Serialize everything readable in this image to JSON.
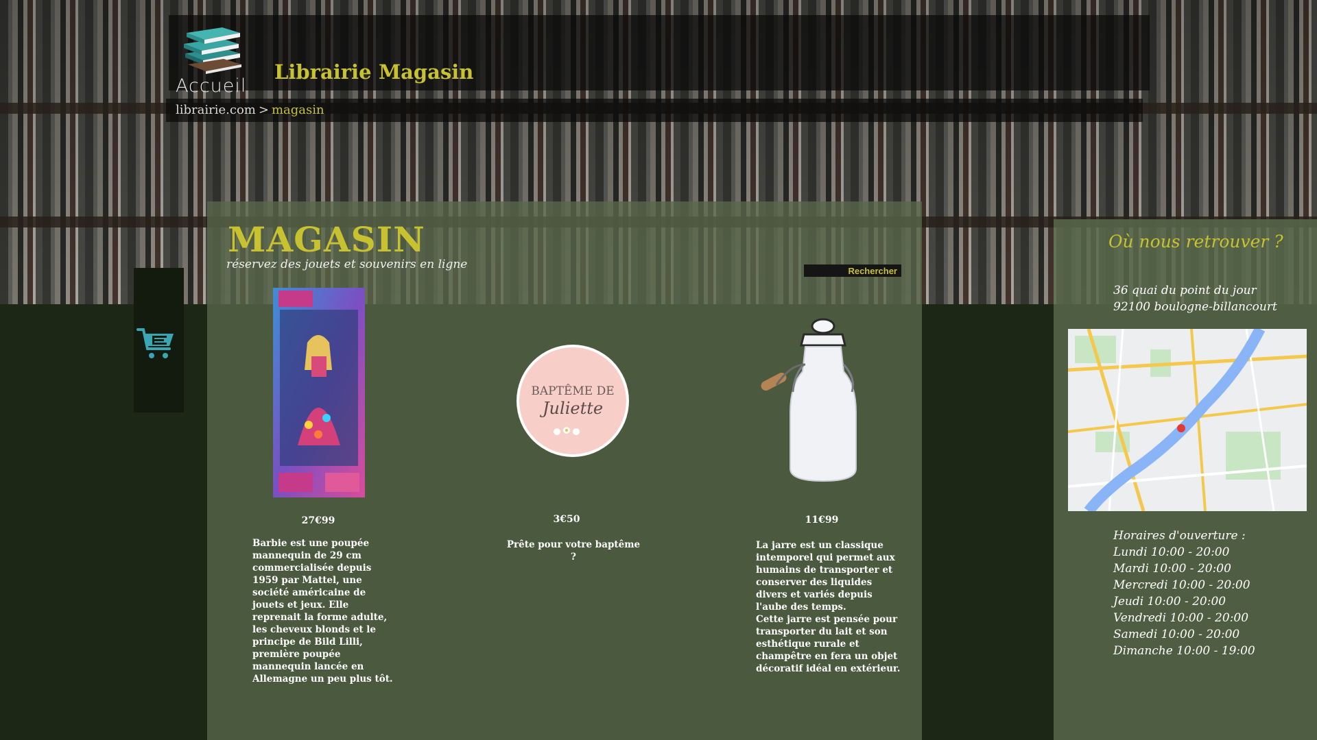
{
  "nav": {
    "home_label": "Accueil",
    "links": [
      "Librairie",
      "Magasin"
    ]
  },
  "breadcrumb": {
    "home": "librairie.com",
    "separator": ">",
    "current": "magasin"
  },
  "main": {
    "title": "MAGASIN",
    "subtitle": "réservez des jouets et souvenirs en ligne",
    "search_label": "Rechercher"
  },
  "products": [
    {
      "price": "27€99",
      "description": "Barbie est une poupée\nmannequin de 29 cm\ncommercialisée depuis\n1959 par Mattel, une\nsociété américaine de\njouets et jeux. Elle\nreprenait la forme adulte,\nles cheveux blonds et le\nprincipe de Bild Lilli,\npremière poupée\nmannequin lancée en\nAllemagne un peu plus tôt."
    },
    {
      "price": "3€50",
      "description": "Prête pour votre baptême ?",
      "badge_line1": "BAPTÊME DE",
      "badge_line2": "Juliette"
    },
    {
      "price": "11€99",
      "description": "La jarre est un classique\nintemporel qui permet aux\nhumains de transporter et\nconserver des liquides\ndivers et variés depuis\nl'aube des temps.\nCette jarre est pensée pour\ntransporter du lait et son\nesthétique rurale et\nchampêtre en fera un objet\ndécoratif idéal en extérieur."
    }
  ],
  "sidebar": {
    "title": "Où nous retrouver ?",
    "address": [
      "36 quai du point du jour",
      "92100 boulogne-billancourt"
    ],
    "hours_title": "Horaires d'ouverture :",
    "hours": [
      "Lundi 10:00 - 20:00",
      "Mardi 10:00 - 20:00",
      "Mercredi 10:00 - 20:00",
      "Jeudi 10:00 - 20:00",
      "Vendredi 10:00 - 20:00",
      "Samedi 10:00 - 20:00",
      "Dimanche 10:00 - 19:00"
    ]
  },
  "colors": {
    "accent": "#c9c230",
    "panel": "#58684a",
    "dark_bg": "#1c2715"
  },
  "icons": [
    "books-logo-icon",
    "shopping-cart-icon"
  ]
}
